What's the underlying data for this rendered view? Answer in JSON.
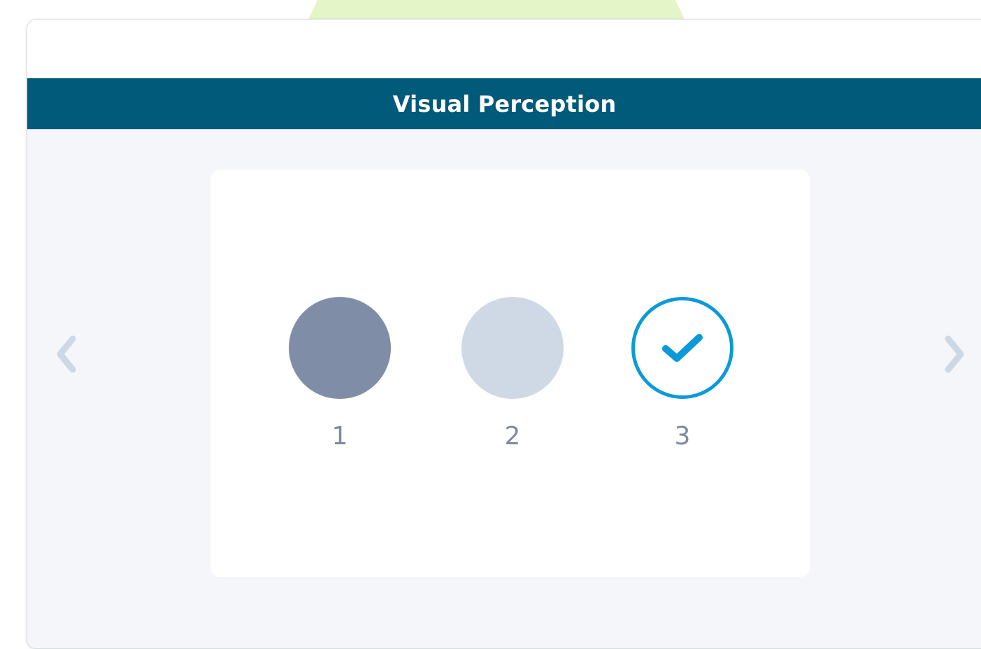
{
  "header": {
    "title": "Visual Perception"
  },
  "steps": [
    {
      "number": "1",
      "state": "complete-dark"
    },
    {
      "number": "2",
      "state": "pending-light"
    },
    {
      "number": "3",
      "state": "selected-check"
    }
  ],
  "icons": {
    "prev": "chevron-left-icon",
    "next": "chevron-right-icon",
    "check": "check-icon"
  },
  "colors": {
    "title_bar": "#025a7b",
    "panel_background": "#f4f6f9",
    "card_background": "#ffffff",
    "step_dark": "#7f8ea6",
    "step_light": "#cfd9e6",
    "accent_blue": "#0b9ad9",
    "chevron": "#cdd8e5",
    "label_text": "#7c8ba3"
  }
}
